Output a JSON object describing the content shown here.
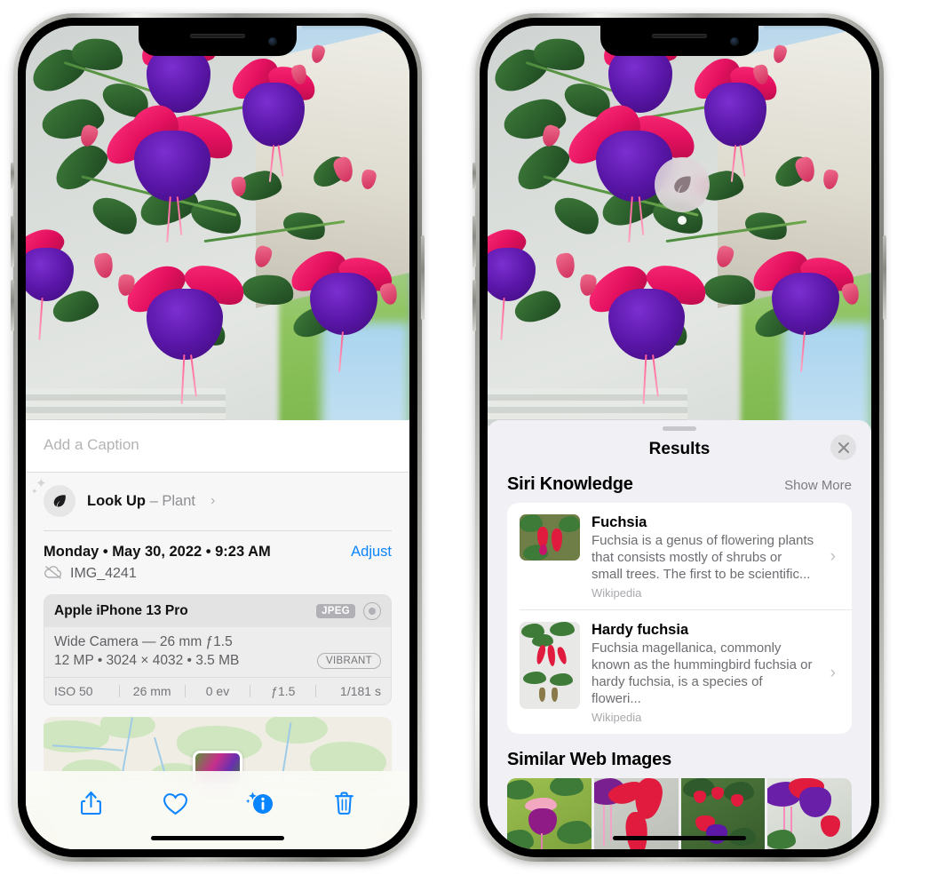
{
  "left_phone": {
    "photo": {
      "alt_name": "fuchsia-flowers-photo"
    },
    "caption": {
      "placeholder": "Add a Caption",
      "value": ""
    },
    "look_up": {
      "label": "Look Up",
      "separator": "–",
      "subject": "Plant",
      "icon": "leaf-icon",
      "chevron": "›"
    },
    "date_row": {
      "date_text": "Monday • May 30, 2022 • 9:23 AM",
      "adjust_label": "Adjust"
    },
    "file_row": {
      "icon": "cloud-slash-icon",
      "file_name": "IMG_4241"
    },
    "camera_card": {
      "model": "Apple iPhone 13 Pro",
      "format_badge": "JPEG",
      "hdr_icon": "hdr-ring-icon",
      "lens_line": "Wide Camera — 26 mm ƒ1.5",
      "size_line": "12 MP • 3024 × 4032 • 3.5 MB",
      "style_badge": "VIBRANT",
      "exif": [
        "ISO 50",
        "26 mm",
        "0 ev",
        "ƒ1.5",
        "1/181 s"
      ]
    },
    "toolbar": [
      {
        "name": "share-button",
        "icon": "share-icon"
      },
      {
        "name": "favorite-button",
        "icon": "heart-icon"
      },
      {
        "name": "info-button",
        "icon": "info-sparkle-icon"
      },
      {
        "name": "delete-button",
        "icon": "trash-icon"
      }
    ],
    "accent_color": "#0a84ff"
  },
  "right_phone": {
    "badge": {
      "icon": "leaf-icon",
      "name": "visual-look-up-badge"
    },
    "sheet": {
      "title": "Results",
      "close_icon": "close-icon",
      "sections": [
        {
          "title": "Siri Knowledge",
          "action": "Show More",
          "items": [
            {
              "title": "Fuchsia",
              "description": "Fuchsia is a genus of flowering plants that consists mostly of shrubs or small trees. The first to be scientific...",
              "source": "Wikipedia",
              "chevron": "›"
            },
            {
              "title": "Hardy fuchsia",
              "description": "Fuchsia magellanica, commonly known as the hummingbird fuchsia or hardy fuchsia, is a species of floweri...",
              "source": "Wikipedia",
              "chevron": "›"
            }
          ]
        },
        {
          "title": "Similar Web Images",
          "thumbnails": [
            "fuchsia-thumb-1",
            "fuchsia-thumb-2",
            "fuchsia-thumb-3",
            "fuchsia-thumb-4"
          ]
        }
      ]
    }
  }
}
